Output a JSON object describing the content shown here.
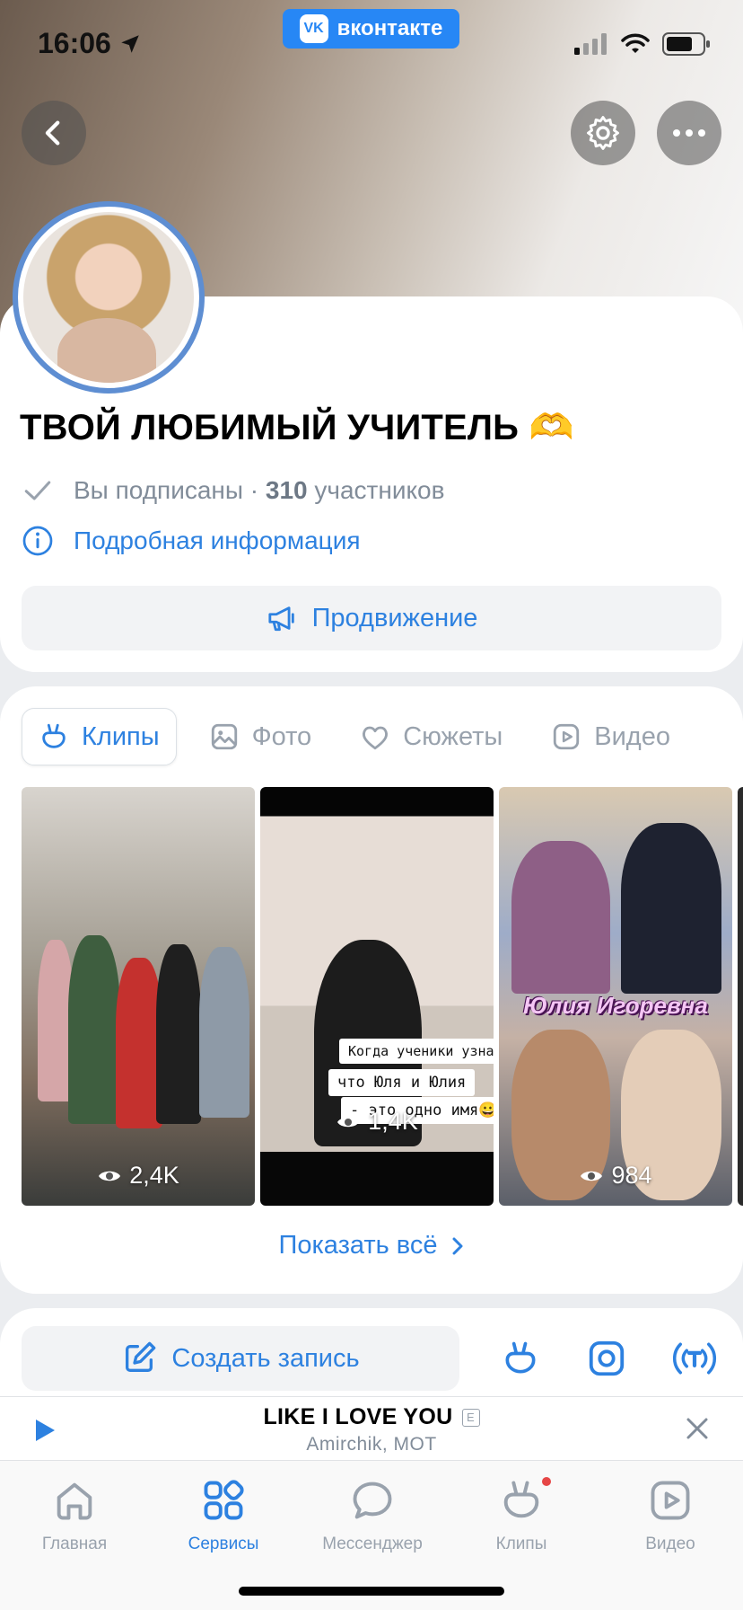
{
  "status_bar": {
    "time": "16:06",
    "app_badge": "вконтакте",
    "vk_logo": "VK"
  },
  "group": {
    "title": "ТВОЙ ЛЮБИМЫЙ УЧИТЕЛЬ 🫶",
    "subscribed": "Вы подписаны · ",
    "members": "310",
    "members_suffix": " участников",
    "more_info": "Подробная информация",
    "promo_button": "Продвижение"
  },
  "media_tabs": [
    {
      "label": "Клипы",
      "icon": "clips-icon",
      "active": true
    },
    {
      "label": "Фото",
      "icon": "photo-icon",
      "active": false
    },
    {
      "label": "Сюжеты",
      "icon": "stories-icon",
      "active": false
    },
    {
      "label": "Видео",
      "icon": "video-icon",
      "active": false
    }
  ],
  "clips": [
    {
      "views": "2,4K"
    },
    {
      "views": "1,4K",
      "caption_1": "Когда ученики узнали,",
      "caption_2": "что Юля и Юлия",
      "caption_3": "- это одно имя😀"
    },
    {
      "views": "984",
      "overlay_title": "Юлия Игоревна"
    }
  ],
  "show_all": "Показать всё",
  "post_bar": {
    "create_label": "Создать запись"
  },
  "player": {
    "title": "LIKE I LOVE YOU",
    "explicit": "E",
    "artist": "Amirchik, MOT"
  },
  "tabbar": [
    {
      "label": "Главная",
      "active": false
    },
    {
      "label": "Сервисы",
      "active": true
    },
    {
      "label": "Мессенджер",
      "active": false
    },
    {
      "label": "Клипы",
      "active": false,
      "badge": true
    },
    {
      "label": "Видео",
      "active": false
    }
  ],
  "colors": {
    "accent": "#2d81e0",
    "vk_blue": "#2787f5",
    "muted": "#99a2ad",
    "badge": "#e64646"
  }
}
